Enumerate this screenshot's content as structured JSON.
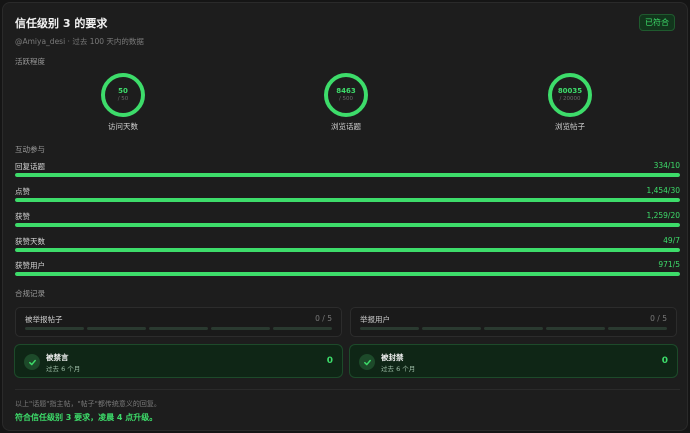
{
  "header": {
    "title": "信任级别 3 的要求",
    "badge": "已符合",
    "subtitle": "@Amiya_desi · 过去 100 天内的数据"
  },
  "activity": {
    "section_label": "活跃程度",
    "rings": [
      {
        "value": "50",
        "requirement": "/ 50",
        "label": "访问天数"
      },
      {
        "value": "8463",
        "requirement": "/ 500",
        "label": "浏览话题"
      },
      {
        "value": "80035",
        "requirement": "/ 20000",
        "label": "浏览帖子"
      }
    ]
  },
  "interaction": {
    "section_label": "互动参与",
    "metrics": [
      {
        "label": "回复话题",
        "value": "334/10",
        "progress": 1.0
      },
      {
        "label": "点赞",
        "value": "1,454/30",
        "progress": 1.0
      },
      {
        "label": "获赞",
        "value": "1,259/20",
        "progress": 1.0
      },
      {
        "label": "获赞天数",
        "value": "49/7",
        "progress": 1.0
      },
      {
        "label": "获赞用户",
        "value": "971/5",
        "progress": 1.0
      }
    ]
  },
  "compliance": {
    "section_label": "合规记录",
    "reports": [
      {
        "label": "被举报帖子",
        "count": "0 / 5"
      },
      {
        "label": "举报用户",
        "count": "0 / 5"
      }
    ],
    "penalties": [
      {
        "title": "被禁言",
        "subtitle": "过去 6 个月",
        "count": "0"
      },
      {
        "title": "被封禁",
        "subtitle": "过去 6 个月",
        "count": "0"
      }
    ]
  },
  "footer": {
    "note": "以上\"话题\"指主帖，\"帖子\"都传统意义的回复。",
    "summary": "符合信任级别 3 要求，凌晨 4 点升级。"
  },
  "colors": {
    "accent": "#3ddc6a",
    "background": "#1d1d1d"
  },
  "icons": {
    "penalty_check": "check-icon"
  }
}
